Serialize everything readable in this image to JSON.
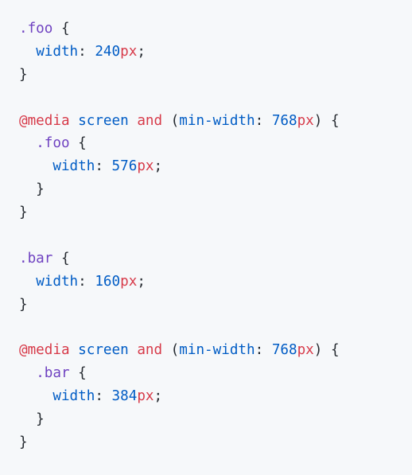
{
  "colors": {
    "background": "#f6f8fa",
    "text": "#24292f",
    "selector": "#6f42c1",
    "property": "#005cc5",
    "unit": "#d73a49",
    "at_rule": "#d73a49"
  },
  "code_lines": [
    [
      {
        "t": "selector",
        "v": ".foo"
      },
      {
        "t": "punc",
        "v": " {"
      }
    ],
    [
      {
        "t": "punc",
        "v": "  "
      },
      {
        "t": "prop",
        "v": "width"
      },
      {
        "t": "punc",
        "v": ": "
      },
      {
        "t": "num",
        "v": "240"
      },
      {
        "t": "unit",
        "v": "px"
      },
      {
        "t": "punc",
        "v": ";"
      }
    ],
    [
      {
        "t": "punc",
        "v": "}"
      }
    ],
    [],
    [
      {
        "t": "atrule",
        "v": "@media"
      },
      {
        "t": "punc",
        "v": " "
      },
      {
        "t": "media",
        "v": "screen"
      },
      {
        "t": "punc",
        "v": " "
      },
      {
        "t": "kw",
        "v": "and"
      },
      {
        "t": "punc",
        "v": " ("
      },
      {
        "t": "media",
        "v": "min-width"
      },
      {
        "t": "punc",
        "v": ": "
      },
      {
        "t": "num",
        "v": "768"
      },
      {
        "t": "unit",
        "v": "px"
      },
      {
        "t": "punc",
        "v": ") {"
      }
    ],
    [
      {
        "t": "punc",
        "v": "  "
      },
      {
        "t": "selector",
        "v": ".foo"
      },
      {
        "t": "punc",
        "v": " {"
      }
    ],
    [
      {
        "t": "punc",
        "v": "    "
      },
      {
        "t": "prop",
        "v": "width"
      },
      {
        "t": "punc",
        "v": ": "
      },
      {
        "t": "num",
        "v": "576"
      },
      {
        "t": "unit",
        "v": "px"
      },
      {
        "t": "punc",
        "v": ";"
      }
    ],
    [
      {
        "t": "punc",
        "v": "  }"
      }
    ],
    [
      {
        "t": "punc",
        "v": "}"
      }
    ],
    [],
    [
      {
        "t": "selector",
        "v": ".bar"
      },
      {
        "t": "punc",
        "v": " {"
      }
    ],
    [
      {
        "t": "punc",
        "v": "  "
      },
      {
        "t": "prop",
        "v": "width"
      },
      {
        "t": "punc",
        "v": ": "
      },
      {
        "t": "num",
        "v": "160"
      },
      {
        "t": "unit",
        "v": "px"
      },
      {
        "t": "punc",
        "v": ";"
      }
    ],
    [
      {
        "t": "punc",
        "v": "}"
      }
    ],
    [],
    [
      {
        "t": "atrule",
        "v": "@media"
      },
      {
        "t": "punc",
        "v": " "
      },
      {
        "t": "media",
        "v": "screen"
      },
      {
        "t": "punc",
        "v": " "
      },
      {
        "t": "kw",
        "v": "and"
      },
      {
        "t": "punc",
        "v": " ("
      },
      {
        "t": "media",
        "v": "min-width"
      },
      {
        "t": "punc",
        "v": ": "
      },
      {
        "t": "num",
        "v": "768"
      },
      {
        "t": "unit",
        "v": "px"
      },
      {
        "t": "punc",
        "v": ") {"
      }
    ],
    [
      {
        "t": "punc",
        "v": "  "
      },
      {
        "t": "selector",
        "v": ".bar"
      },
      {
        "t": "punc",
        "v": " {"
      }
    ],
    [
      {
        "t": "punc",
        "v": "    "
      },
      {
        "t": "prop",
        "v": "width"
      },
      {
        "t": "punc",
        "v": ": "
      },
      {
        "t": "num",
        "v": "384"
      },
      {
        "t": "unit",
        "v": "px"
      },
      {
        "t": "punc",
        "v": ";"
      }
    ],
    [
      {
        "t": "punc",
        "v": "  }"
      }
    ],
    [
      {
        "t": "punc",
        "v": "}"
      }
    ]
  ]
}
